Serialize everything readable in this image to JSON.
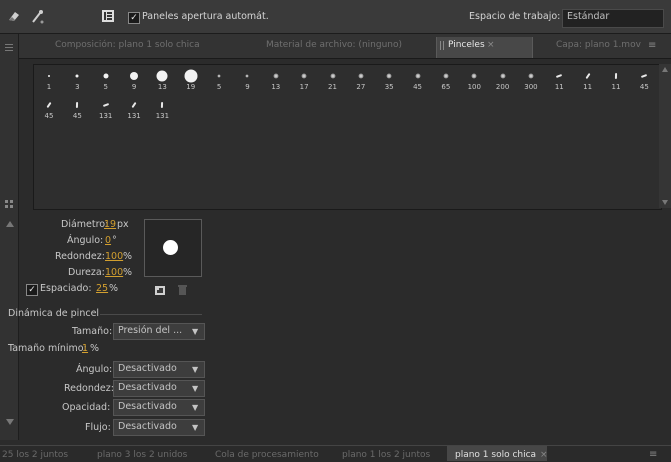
{
  "toolbar": {
    "auto_open_label": "Paneles apertura automát.",
    "auto_open_checked": "✓",
    "workspace_label": "Espacio de trabajo:",
    "workspace_value": "Estándar"
  },
  "tabs": [
    {
      "label": "Composición: plano 1 solo chica"
    },
    {
      "label": "Material de archivo: (ninguno)"
    },
    {
      "label": "Pinceles",
      "close": "×"
    },
    {
      "label": "Capa: plano 1.mov"
    }
  ],
  "panel_menu_icon": "≡",
  "brushes": [
    {
      "size": "1",
      "shape": "dot"
    },
    {
      "size": "3",
      "shape": "dot"
    },
    {
      "size": "5",
      "shape": "dot"
    },
    {
      "size": "9",
      "shape": "dot"
    },
    {
      "size": "13",
      "shape": "dot"
    },
    {
      "size": "19",
      "shape": "dot"
    },
    {
      "size": "5",
      "shape": "soft"
    },
    {
      "size": "9",
      "shape": "soft"
    },
    {
      "size": "13",
      "shape": "soft"
    },
    {
      "size": "17",
      "shape": "soft"
    },
    {
      "size": "21",
      "shape": "soft"
    },
    {
      "size": "27",
      "shape": "soft"
    },
    {
      "size": "35",
      "shape": "soft"
    },
    {
      "size": "45",
      "shape": "soft"
    },
    {
      "size": "65",
      "shape": "soft"
    },
    {
      "size": "100",
      "shape": "soft"
    },
    {
      "size": "200",
      "shape": "soft"
    },
    {
      "size": "300",
      "shape": "soft"
    },
    {
      "size": "11",
      "shape": "stroke-h"
    },
    {
      "size": "11",
      "shape": "stroke-d"
    },
    {
      "size": "11",
      "shape": "stroke-v"
    },
    {
      "size": "45",
      "shape": "stroke-h"
    },
    {
      "size": "45",
      "shape": "stroke-d"
    },
    {
      "size": "45",
      "shape": "stroke-v"
    },
    {
      "size": "131",
      "shape": "stroke-h"
    },
    {
      "size": "131",
      "shape": "stroke-d"
    },
    {
      "size": "131",
      "shape": "stroke-v"
    }
  ],
  "params": {
    "diameter_label": "Diámetro:",
    "diameter_value": "19",
    "diameter_unit": "px",
    "angle_label": "Ángulo:",
    "angle_value": "0",
    "angle_unit": "°",
    "roundness_label": "Redondez:",
    "roundness_value": "100",
    "roundness_unit": "%",
    "hardness_label": "Dureza:",
    "hardness_value": "100",
    "hardness_unit": "%",
    "spacing_label": "Espaciado:",
    "spacing_value": "25",
    "spacing_unit": "%",
    "spacing_checked": "✓"
  },
  "dynamics": {
    "title": "Dinámica de pincel",
    "size_label": "Tamaño:",
    "size_value": "Presión del ...",
    "min_size_label": "Tamaño mínimo:",
    "min_size_value": "1",
    "min_size_unit": "%",
    "angle_label": "Ángulo:",
    "angle_value": "Desactivado",
    "roundness_label": "Redondez:",
    "roundness_value": "Desactivado",
    "opacity_label": "Opacidad:",
    "opacity_value": "Desactivado",
    "flow_label": "Flujo:",
    "flow_value": "Desactivado",
    "arrow": "▼"
  },
  "bottom_tabs": [
    {
      "label": "25 los 2 juntos"
    },
    {
      "label": "plano 3 los 2 unidos"
    },
    {
      "label": "Cola de procesamiento"
    },
    {
      "label": "plano 1  los 2 juntos"
    },
    {
      "label": "plano 1 solo chica",
      "close": "×"
    }
  ],
  "colors": {
    "accent": "#d29f2f",
    "panel": "#2b2b2b",
    "active_tab": "#484848"
  }
}
